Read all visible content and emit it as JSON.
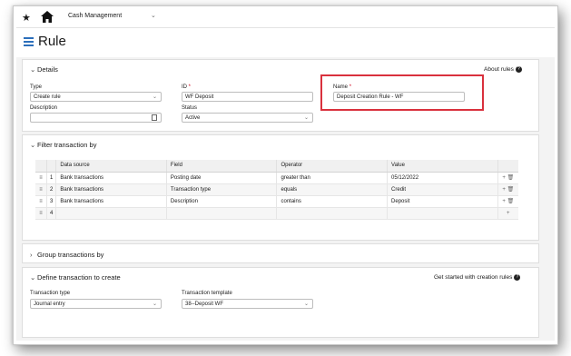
{
  "topbar": {
    "module": "Cash Management"
  },
  "page": {
    "title": "Rule"
  },
  "details": {
    "title": "Details",
    "help": "About rules",
    "type_label": "Type",
    "type_value": "Create rule",
    "id_label": "ID",
    "id_value": "WF Deposit",
    "name_label": "Name",
    "name_value": "Deposit Creation Rule - WF",
    "description_label": "Description",
    "description_value": "",
    "status_label": "Status",
    "status_value": "Active"
  },
  "filter": {
    "title": "Filter transaction by",
    "columns": [
      "Data source",
      "Field",
      "Operator",
      "Value"
    ],
    "rows": [
      {
        "num": "1",
        "source": "Bank transactions",
        "field": "Posting date",
        "operator": "greater than",
        "value": "05/12/2022"
      },
      {
        "num": "2",
        "source": "Bank transactions",
        "field": "Transaction type",
        "operator": "equals",
        "value": "Credit"
      },
      {
        "num": "3",
        "source": "Bank transactions",
        "field": "Description",
        "operator": "contains",
        "value": "Deposit"
      },
      {
        "num": "4",
        "source": "",
        "field": "",
        "operator": "",
        "value": ""
      }
    ]
  },
  "group": {
    "title": "Group transactions by"
  },
  "define": {
    "title": "Define transaction to create",
    "help": "Get started with creation rules",
    "txn_type_label": "Transaction type",
    "txn_type_value": "Journal entry",
    "template_label": "Transaction template",
    "template_value": "38--Deposit WF"
  },
  "icons": {
    "favorite": "star-icon",
    "home": "home-icon",
    "menu": "list-icon",
    "help": "question-icon",
    "calendar": "calendar-icon",
    "drag": "drag-handle-icon",
    "add": "plus-icon",
    "delete": "trash-icon"
  },
  "colors": {
    "accent": "#2c6fbb",
    "highlight_box": "#d9313d",
    "required": "#d0021b"
  }
}
